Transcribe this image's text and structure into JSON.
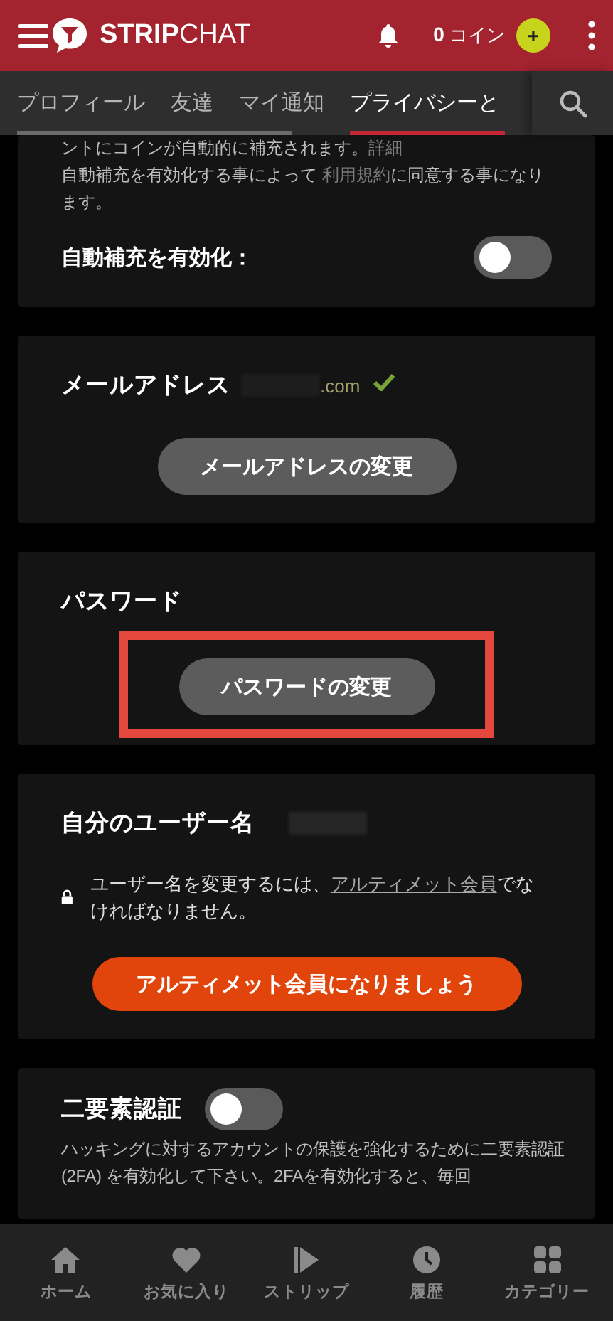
{
  "header": {
    "logo": "**STRIP**CHAT",
    "coins": "**0** コイン",
    "add_coins": "+"
  },
  "tabs": [
    {
      "label": "プロフィール",
      "selected": false
    },
    {
      "label": "友達",
      "selected": false
    },
    {
      "label": "マイ通知",
      "selected": false
    },
    {
      "label": "プライバシーと",
      "selected": true
    }
  ],
  "sections": [
    {
      "kind": "auto_refill",
      "description": [
        [
          {
            "text": "ントにコインが自動的に補充されます。"
          },
          {
            "text": "詳細",
            "kind": "link"
          }
        ],
        [
          {
            "text": "自動補充を有効化する事によって "
          },
          {
            "text": "利用規約",
            "kind": "link"
          },
          {
            "text": "に同意する事になります。"
          }
        ]
      ],
      "toggle_label": "自動補充を有効化：",
      "on": false
    },
    {
      "kind": "email",
      "title": "メールアドレス",
      "email_suffix": ".com",
      "verified": true,
      "button": "メールアドレスの変更"
    },
    {
      "kind": "password",
      "title": "パスワード",
      "button": "パスワードの変更",
      "highlighted": true
    },
    {
      "kind": "username",
      "title": "自分のユーザー名",
      "notice": [
        {
          "text": "ユーザー名を変更するには、"
        },
        {
          "text": "アルティメット会員",
          "kind": "link"
        },
        {
          "text": "でなければなりません。"
        }
      ],
      "button": "アルティメット会員になりましょう"
    },
    {
      "kind": "two_factor",
      "title": "二要素認証",
      "on": false,
      "description": "ハッキングに対するアカウントの保護を強化するために二要素認証(2FA) を有効化して下さい。2FAを有効化すると、毎回"
    }
  ],
  "bottom_nav": [
    {
      "kind": "home",
      "label": "ホーム",
      "selected": false
    },
    {
      "kind": "favorites",
      "label": "お気に入り",
      "selected": false
    },
    {
      "kind": "strip",
      "label": "ストリップ",
      "selected": false
    },
    {
      "kind": "history",
      "label": "履歴",
      "selected": false
    },
    {
      "kind": "categories",
      "label": "カテゴリー",
      "selected": false
    }
  ]
}
